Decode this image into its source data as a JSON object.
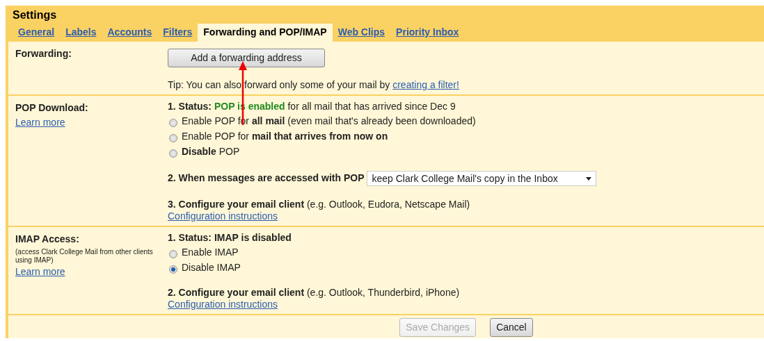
{
  "title": "Settings",
  "tabs": [
    {
      "label": "General",
      "selected": false
    },
    {
      "label": "Labels",
      "selected": false
    },
    {
      "label": "Accounts",
      "selected": false
    },
    {
      "label": "Filters",
      "selected": false
    },
    {
      "label": "Forwarding and POP/IMAP",
      "selected": true
    },
    {
      "label": "Web Clips",
      "selected": false
    },
    {
      "label": "Priority Inbox",
      "selected": false
    }
  ],
  "sections": [
    {
      "label": "Forwarding:",
      "items": [
        {
          "kind": "button",
          "text": "Add a forwarding address"
        },
        {
          "kind": "tip",
          "text": "Tip: You can also forward only some of your mail by",
          "link": "creating a filter!"
        }
      ]
    },
    {
      "label": "POP Download:",
      "learn_more": "Learn more",
      "items": [
        {
          "kind": "status",
          "label": "1. Status:",
          "value": "POP is enabled",
          "rest": "for all mail that has arrived since Dec 9",
          "enabled": true
        },
        {
          "kind": "radio",
          "text": "Enable POP for **all mail** (even mail that's already been downloaded)",
          "selected": false
        },
        {
          "kind": "radio",
          "text": "Enable POP for **mail that arrives from now on**",
          "selected": false
        },
        {
          "kind": "radio",
          "text": "**Disable** POP",
          "selected": false
        },
        {
          "kind": "select",
          "label": "2. When messages are accessed with POP",
          "value": "keep Clark College Mail's copy in the Inbox"
        },
        {
          "kind": "heading",
          "text": "**3. Configure your email client** (e.g. Outlook, Eudora, Netscape Mail)"
        },
        {
          "kind": "link",
          "text": "Configuration instructions"
        }
      ]
    },
    {
      "label": "IMAP Access:",
      "note": "(access Clark College Mail from other clients using IMAP)",
      "learn_more": "Learn more",
      "items": [
        {
          "kind": "status",
          "label": "1. Status:",
          "value": "IMAP is disabled",
          "enabled": false
        },
        {
          "kind": "radio",
          "text": "Enable IMAP",
          "selected": false
        },
        {
          "kind": "radio",
          "text": "Disable IMAP",
          "selected": true
        },
        {
          "kind": "heading",
          "text": "**2. Configure your email client** (e.g. Outlook, Thunderbird, iPhone)"
        },
        {
          "kind": "link",
          "text": "Configuration instructions"
        }
      ]
    }
  ],
  "footer_buttons": [
    {
      "label": "Save Changes",
      "disabled": true
    },
    {
      "label": "Cancel",
      "disabled": false
    }
  ]
}
